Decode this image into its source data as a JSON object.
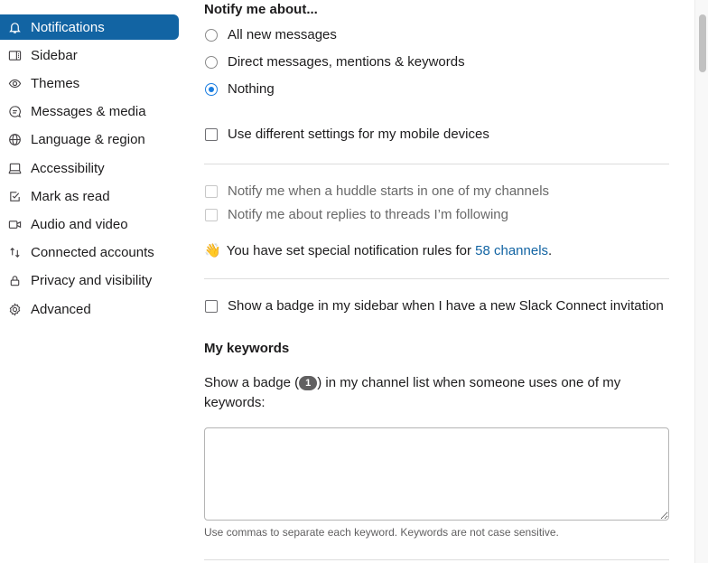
{
  "sidebar": {
    "items": [
      {
        "label": "Notifications",
        "icon": "bell-icon",
        "active": true
      },
      {
        "label": "Sidebar",
        "icon": "sidebar-icon",
        "active": false
      },
      {
        "label": "Themes",
        "icon": "eye-icon",
        "active": false
      },
      {
        "label": "Messages & media",
        "icon": "message-icon",
        "active": false
      },
      {
        "label": "Language & region",
        "icon": "globe-icon",
        "active": false
      },
      {
        "label": "Accessibility",
        "icon": "laptop-icon",
        "active": false
      },
      {
        "label": "Mark as read",
        "icon": "check-square-icon",
        "active": false
      },
      {
        "label": "Audio and video",
        "icon": "video-icon",
        "active": false
      },
      {
        "label": "Connected accounts",
        "icon": "arrows-updown-icon",
        "active": false
      },
      {
        "label": "Privacy and visibility",
        "icon": "lock-icon",
        "active": false
      },
      {
        "label": "Advanced",
        "icon": "gear-icon",
        "active": false
      }
    ]
  },
  "notify": {
    "title": "Notify me about...",
    "options": [
      {
        "label": "All new messages",
        "checked": false
      },
      {
        "label": "Direct messages, mentions & keywords",
        "checked": false
      },
      {
        "label": "Nothing",
        "checked": true
      }
    ],
    "mobile_label": "Use different settings for my mobile devices",
    "mobile_checked": false
  },
  "extra": {
    "huddle_label": "Notify me when a huddle starts in one of my channels",
    "threads_label": "Notify me about replies to threads I’m following",
    "rules_emoji": "👋",
    "rules_prefix": "You have set special notification rules for ",
    "rules_link": "58 channels",
    "rules_suffix": "."
  },
  "connect": {
    "label": "Show a badge in my sidebar when I have a new Slack Connect invitation",
    "checked": false
  },
  "keywords": {
    "title": "My keywords",
    "desc_prefix": "Show a badge (",
    "badge": "1",
    "desc_suffix": ") in my channel list when someone uses one of my keywords:",
    "value": "",
    "hint": "Use commas to separate each keyword. Keywords are not case sensitive."
  },
  "colors": {
    "accent": "#1264a3",
    "radio_selected": "#1a7de0"
  }
}
